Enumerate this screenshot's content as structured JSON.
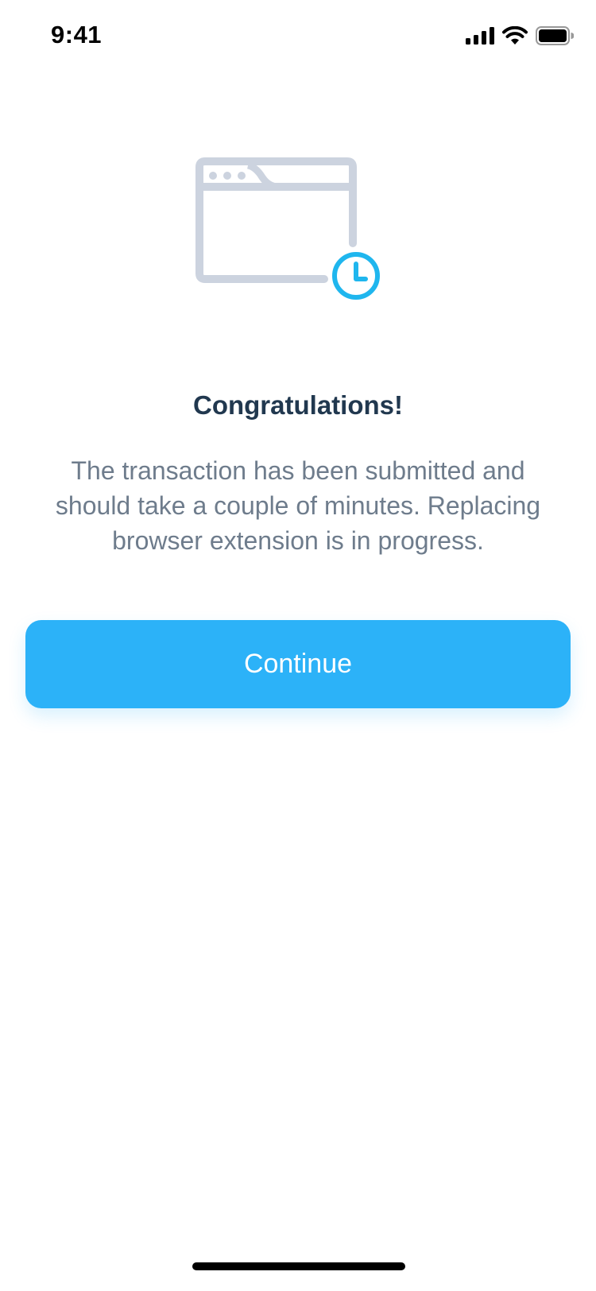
{
  "status_bar": {
    "time": "9:41",
    "icons": [
      "signal-icon",
      "wifi-icon",
      "battery-icon"
    ]
  },
  "illustration": {
    "icons": [
      "browser-window-icon",
      "clock-icon"
    ],
    "colors": {
      "window": "#ccd3df",
      "clock": "#1fb6ee"
    }
  },
  "content": {
    "title": "Congratulations!",
    "message": "The transaction has been submitted and should take a couple of minutes. Replacing browser extension is in progress."
  },
  "actions": {
    "continue_label": "Continue"
  },
  "colors": {
    "accent": "#2cb2f8",
    "title": "#21384f",
    "body_text": "#6e7c8c"
  }
}
